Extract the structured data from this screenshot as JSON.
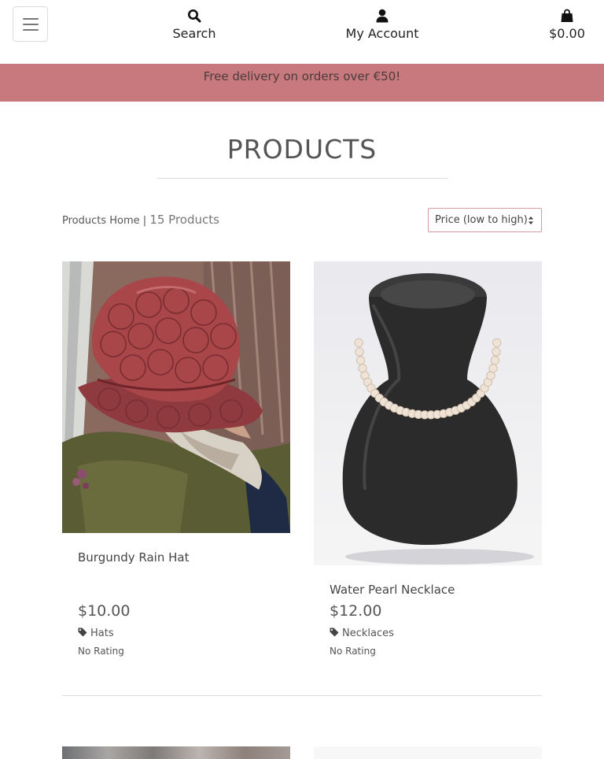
{
  "header": {
    "menu_icon": "hamburger-icon",
    "search": {
      "label": "Search",
      "icon": "search-icon"
    },
    "account": {
      "label": "My Account",
      "icon": "user-icon"
    },
    "bag": {
      "label": "$0.00",
      "icon": "shopping-bag-icon"
    }
  },
  "banner": {
    "text": "Free delivery on orders over €50!",
    "color": "#c7797d"
  },
  "page": {
    "title": "PRODUCTS",
    "breadcrumb_home": "Products Home",
    "separator": "|",
    "product_count": "15 Products"
  },
  "sort": {
    "selected": "Price (low to high)",
    "border_color": "#d49aa0"
  },
  "products": [
    {
      "name": "Burgundy Rain Hat",
      "price": "$10.00",
      "category": "Hats",
      "rating": "No Rating",
      "image": "burgundy-rain-hat-photo"
    },
    {
      "name": "Water Pearl Necklace",
      "price": "$12.00",
      "category": "Necklaces",
      "rating": "No Rating",
      "image": "pearl-necklace-photo"
    }
  ]
}
